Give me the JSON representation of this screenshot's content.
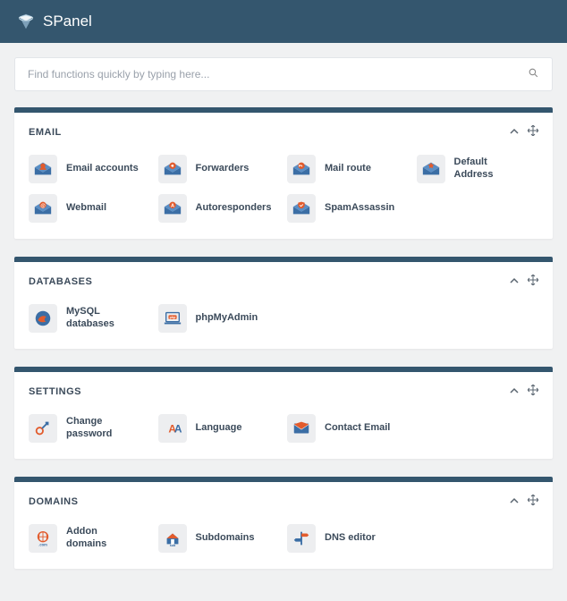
{
  "brand": "SPanel",
  "search_placeholder": "Find functions quickly by typing here...",
  "colors": {
    "brand": "#34566e",
    "accent_blue": "#3b6ea5",
    "accent_orange": "#e25b2c"
  },
  "panels": [
    {
      "title": "EMAIL",
      "items": [
        {
          "label": "Email accounts",
          "icon": "envelope-person"
        },
        {
          "label": "Forwarders",
          "icon": "envelope-arrow"
        },
        {
          "label": "Mail route",
          "icon": "envelope-route"
        },
        {
          "label": "Default Address",
          "icon": "envelope-star"
        },
        {
          "label": "Webmail",
          "icon": "envelope-at"
        },
        {
          "label": "Autoresponders",
          "icon": "envelope-a"
        },
        {
          "label": "SpamAssassin",
          "icon": "envelope-shield"
        }
      ]
    },
    {
      "title": "DATABASES",
      "items": [
        {
          "label": "MySQL databases",
          "icon": "db-dolphin"
        },
        {
          "label": "phpMyAdmin",
          "icon": "laptop-pma"
        }
      ]
    },
    {
      "title": "SETTINGS",
      "items": [
        {
          "label": "Change password",
          "icon": "key"
        },
        {
          "label": "Language",
          "icon": "letters"
        },
        {
          "label": "Contact Email",
          "icon": "envelope-plain"
        }
      ]
    },
    {
      "title": "DOMAINS",
      "items": [
        {
          "label": "Addon domains",
          "icon": "globe-com"
        },
        {
          "label": "Subdomains",
          "icon": "house-sub"
        },
        {
          "label": "DNS editor",
          "icon": "signpost"
        }
      ]
    }
  ]
}
